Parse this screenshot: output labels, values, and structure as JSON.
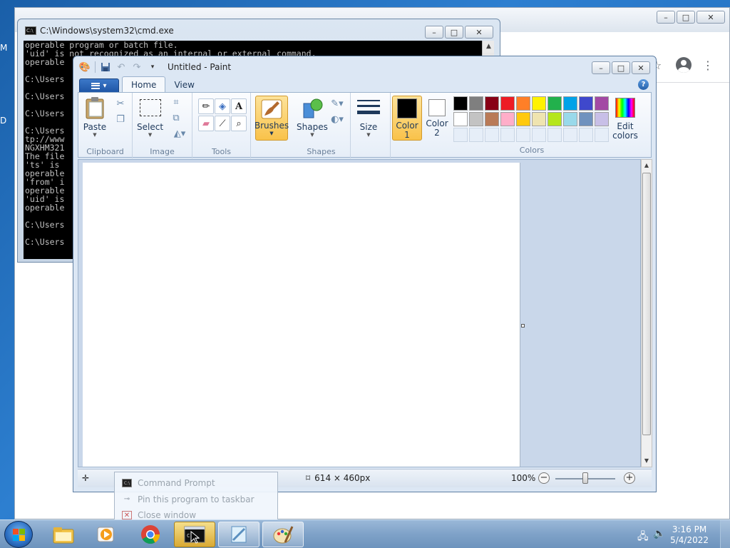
{
  "chrome": {
    "win_min": "–",
    "win_max": "□",
    "win_close": "✕"
  },
  "cmd": {
    "title": "C:\\Windows\\system32\\cmd.exe",
    "lines": [
      "operable program or batch file.",
      "'uid' is not recognized as an internal or external command,",
      "operable",
      "",
      "C:\\Users",
      "",
      "C:\\Users",
      "",
      "C:\\Users",
      "",
      "C:\\Users",
      "tp://www",
      "NGXHM321",
      "The file",
      "'ts' is",
      "operable",
      "'from' i",
      "operable",
      "'uid' is",
      "operable",
      "",
      "C:\\Users",
      "",
      "C:\\Users"
    ]
  },
  "paint": {
    "title": "Untitled - Paint",
    "tabs": [
      {
        "label": "Home",
        "active": true
      },
      {
        "label": "View",
        "active": false
      }
    ],
    "groups": {
      "clipboard": "Clipboard",
      "image": "Image",
      "tools": "Tools",
      "shapes": "Shapes",
      "colors": "Colors"
    },
    "buttons": {
      "paste": "Paste",
      "select": "Select",
      "brushes": "Brushes",
      "shapes": "Shapes",
      "size": "Size",
      "color1": "Color 1",
      "color2": "Color 2",
      "edit_colors": "Edit colors"
    },
    "color1": "#000000",
    "color2": "#ffffff",
    "palette": [
      "#000000",
      "#7f7f7f",
      "#880015",
      "#ed1c24",
      "#ff7f27",
      "#fff200",
      "#22b14c",
      "#00a2e8",
      "#3f48cc",
      "#a349a4",
      "#ffffff",
      "#c3c3c3",
      "#b97a57",
      "#ffaec9",
      "#ffc90e",
      "#efe4b0",
      "#b5e61d",
      "#99d9ea",
      "#7092be",
      "#c8bfe7"
    ],
    "status": {
      "canvas_size": "614 × 460px",
      "zoom": "100%"
    },
    "zoom_level": 1.0
  },
  "jumplist": {
    "items": [
      "Command Prompt",
      "Pin this program to taskbar",
      "Close window"
    ]
  },
  "taskbar": {
    "time": "3:16 PM",
    "date": "5/4/2022"
  },
  "desktop": {
    "left_letters": [
      "M",
      "D"
    ]
  }
}
